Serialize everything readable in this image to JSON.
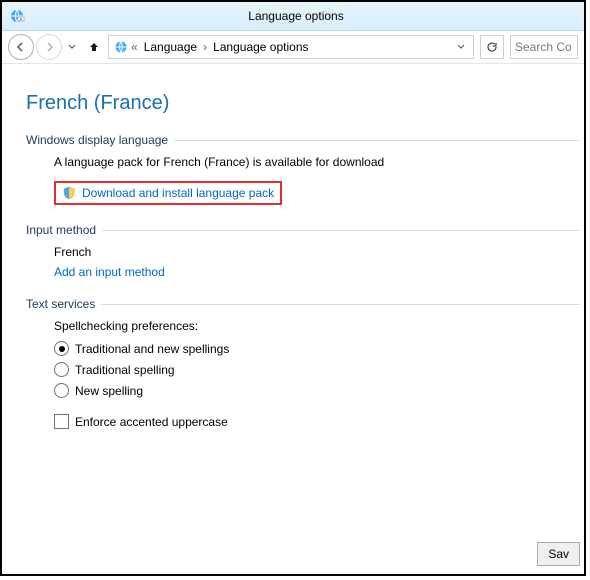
{
  "window": {
    "title": "Language options"
  },
  "nav": {
    "breadcrumb": {
      "root": "Language",
      "current": "Language options"
    },
    "search_placeholder": "Search Co"
  },
  "page": {
    "heading": "French (France)"
  },
  "display_language": {
    "section_label": "Windows display language",
    "status_text": "A language pack for French (France) is available for download",
    "download_link": "Download and install language pack"
  },
  "input_method": {
    "section_label": "Input method",
    "current": "French",
    "add_link": "Add an input method"
  },
  "text_services": {
    "section_label": "Text services",
    "spellcheck_label": "Spellchecking preferences:",
    "options": {
      "both": "Traditional and new spellings",
      "traditional": "Traditional spelling",
      "new": "New spelling"
    },
    "enforce_accented": "Enforce accented uppercase"
  },
  "buttons": {
    "save": "Sav"
  }
}
